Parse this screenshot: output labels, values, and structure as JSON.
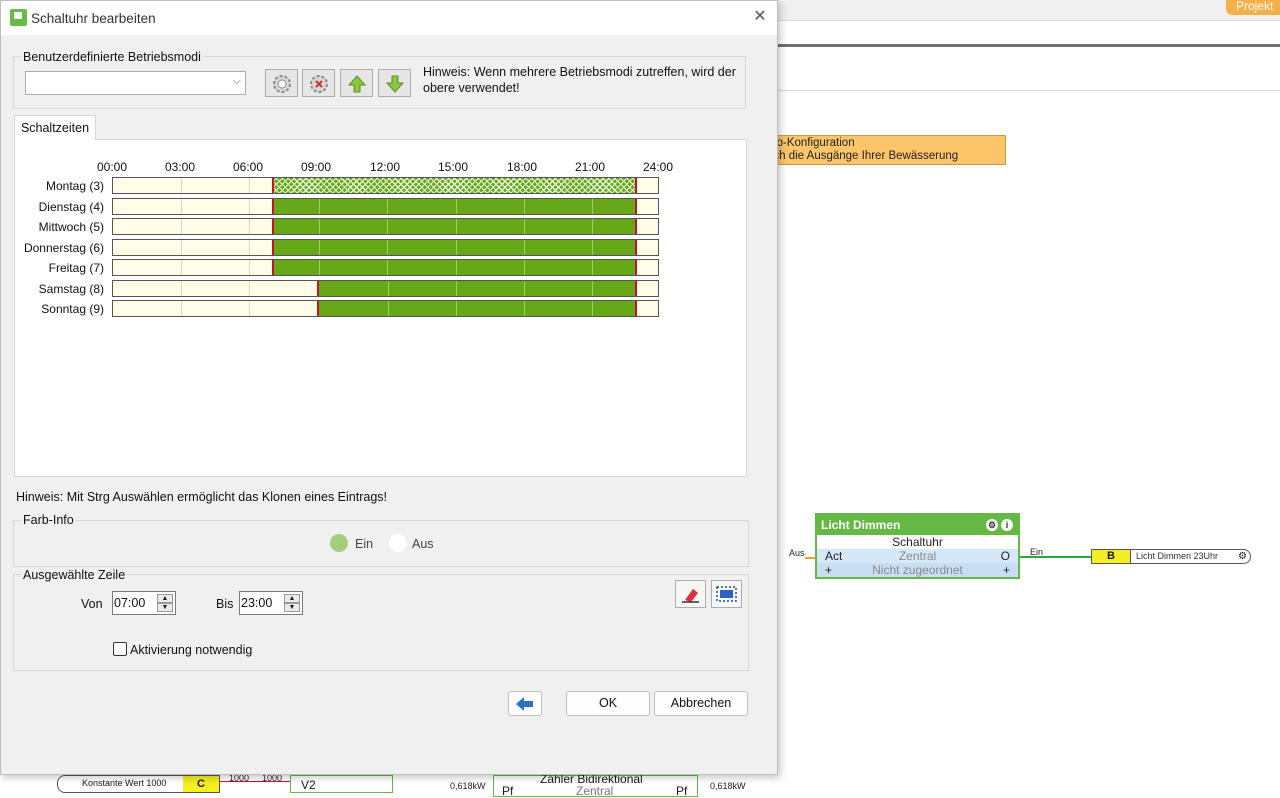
{
  "background": {
    "projekt_button": "Projekt",
    "note_lines": [
      "uto-Konfiguration",
      "och die Ausgänge Ihrer Bewässerung"
    ],
    "block": {
      "title": "Licht Dimmen",
      "subtitle": "Schaltuhr",
      "row1_left": "Act",
      "row1_center": "Zentral",
      "row1_right": "O",
      "row2_left": "+",
      "row2_center": "Nicht zugeordnet",
      "row2_right": "+",
      "input_label": "Aus",
      "output_label": "Ein"
    },
    "output_block": {
      "letter": "B",
      "text": "Licht Dimmen 23Uhr"
    },
    "bottom": {
      "konst_text": "Konstante Wert 1000",
      "konst_letter": "C",
      "wire_label_a": "1000",
      "wire_label_b": "1000",
      "v2_label": "V2",
      "kw_left": "0,618kW",
      "pf_left": "Pf",
      "bidir_title": "Zähler Bidirektional",
      "bidir_sub": "Zentral",
      "pf_right": "Pf",
      "kw_right": "0,618kW"
    }
  },
  "dialog": {
    "title": "Schaltuhr bearbeiten",
    "modes_group_label": "Benutzerdefinierte Betriebsmodi",
    "modes_combo_value": "",
    "hint_modes": "Hinweis: Wenn mehrere Betriebsmodi zutreffen, wird der obere verwendet!",
    "tab_label": "Schaltzeiten",
    "hours": [
      "00:00",
      "03:00",
      "06:00",
      "09:00",
      "12:00",
      "15:00",
      "18:00",
      "21:00",
      "24:00"
    ],
    "days": [
      {
        "label": "Montag (3)",
        "on_from": "07:00",
        "on_to": "23:00",
        "hatched": true
      },
      {
        "label": "Dienstag (4)",
        "on_from": "07:00",
        "on_to": "23:00",
        "hatched": false
      },
      {
        "label": "Mittwoch (5)",
        "on_from": "07:00",
        "on_to": "23:00",
        "hatched": false
      },
      {
        "label": "Donnerstag (6)",
        "on_from": "07:00",
        "on_to": "23:00",
        "hatched": false
      },
      {
        "label": "Freitag (7)",
        "on_from": "07:00",
        "on_to": "23:00",
        "hatched": false
      },
      {
        "label": "Samstag (8)",
        "on_from": "09:00",
        "on_to": "23:00",
        "hatched": false
      },
      {
        "label": "Sonntag (9)",
        "on_from": "09:00",
        "on_to": "23:00",
        "hatched": false
      }
    ],
    "hint_clone": "Hinweis: Mit Strg Auswählen ermöglicht das Klonen eines Eintrags!",
    "color_info_label": "Farb-Info",
    "legend_on": "Ein",
    "legend_off": "Aus",
    "selected_row_label": "Ausgewählte Zeile",
    "from_label": "Von",
    "from_value": "07:00",
    "to_label": "Bis",
    "to_value": "23:00",
    "activation_label": "Aktivierung notwendig",
    "activation_checked": false,
    "ok_label": "OK",
    "cancel_label": "Abbrechen"
  },
  "colors": {
    "on": "#66a818",
    "off": "#fffce8",
    "edge": "#c8102e",
    "legend_on": "#a6cf7a",
    "legend_off": "#ffffff",
    "block_green": "#66b845"
  }
}
